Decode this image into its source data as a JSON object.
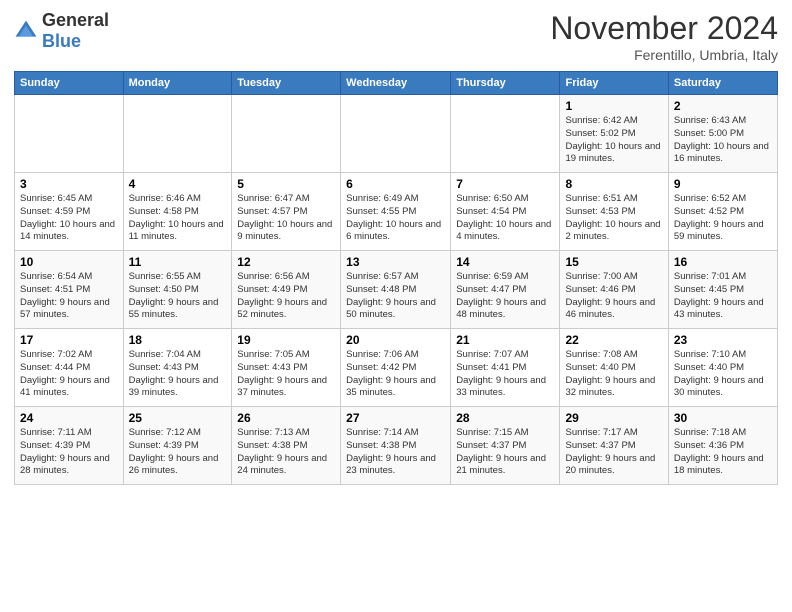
{
  "header": {
    "logo_general": "General",
    "logo_blue": "Blue",
    "month_title": "November 2024",
    "location": "Ferentillo, Umbria, Italy"
  },
  "weekdays": [
    "Sunday",
    "Monday",
    "Tuesday",
    "Wednesday",
    "Thursday",
    "Friday",
    "Saturday"
  ],
  "weeks": [
    [
      {
        "day": "",
        "info": ""
      },
      {
        "day": "",
        "info": ""
      },
      {
        "day": "",
        "info": ""
      },
      {
        "day": "",
        "info": ""
      },
      {
        "day": "",
        "info": ""
      },
      {
        "day": "1",
        "info": "Sunrise: 6:42 AM\nSunset: 5:02 PM\nDaylight: 10 hours and 19 minutes."
      },
      {
        "day": "2",
        "info": "Sunrise: 6:43 AM\nSunset: 5:00 PM\nDaylight: 10 hours and 16 minutes."
      }
    ],
    [
      {
        "day": "3",
        "info": "Sunrise: 6:45 AM\nSunset: 4:59 PM\nDaylight: 10 hours and 14 minutes."
      },
      {
        "day": "4",
        "info": "Sunrise: 6:46 AM\nSunset: 4:58 PM\nDaylight: 10 hours and 11 minutes."
      },
      {
        "day": "5",
        "info": "Sunrise: 6:47 AM\nSunset: 4:57 PM\nDaylight: 10 hours and 9 minutes."
      },
      {
        "day": "6",
        "info": "Sunrise: 6:49 AM\nSunset: 4:55 PM\nDaylight: 10 hours and 6 minutes."
      },
      {
        "day": "7",
        "info": "Sunrise: 6:50 AM\nSunset: 4:54 PM\nDaylight: 10 hours and 4 minutes."
      },
      {
        "day": "8",
        "info": "Sunrise: 6:51 AM\nSunset: 4:53 PM\nDaylight: 10 hours and 2 minutes."
      },
      {
        "day": "9",
        "info": "Sunrise: 6:52 AM\nSunset: 4:52 PM\nDaylight: 9 hours and 59 minutes."
      }
    ],
    [
      {
        "day": "10",
        "info": "Sunrise: 6:54 AM\nSunset: 4:51 PM\nDaylight: 9 hours and 57 minutes."
      },
      {
        "day": "11",
        "info": "Sunrise: 6:55 AM\nSunset: 4:50 PM\nDaylight: 9 hours and 55 minutes."
      },
      {
        "day": "12",
        "info": "Sunrise: 6:56 AM\nSunset: 4:49 PM\nDaylight: 9 hours and 52 minutes."
      },
      {
        "day": "13",
        "info": "Sunrise: 6:57 AM\nSunset: 4:48 PM\nDaylight: 9 hours and 50 minutes."
      },
      {
        "day": "14",
        "info": "Sunrise: 6:59 AM\nSunset: 4:47 PM\nDaylight: 9 hours and 48 minutes."
      },
      {
        "day": "15",
        "info": "Sunrise: 7:00 AM\nSunset: 4:46 PM\nDaylight: 9 hours and 46 minutes."
      },
      {
        "day": "16",
        "info": "Sunrise: 7:01 AM\nSunset: 4:45 PM\nDaylight: 9 hours and 43 minutes."
      }
    ],
    [
      {
        "day": "17",
        "info": "Sunrise: 7:02 AM\nSunset: 4:44 PM\nDaylight: 9 hours and 41 minutes."
      },
      {
        "day": "18",
        "info": "Sunrise: 7:04 AM\nSunset: 4:43 PM\nDaylight: 9 hours and 39 minutes."
      },
      {
        "day": "19",
        "info": "Sunrise: 7:05 AM\nSunset: 4:43 PM\nDaylight: 9 hours and 37 minutes."
      },
      {
        "day": "20",
        "info": "Sunrise: 7:06 AM\nSunset: 4:42 PM\nDaylight: 9 hours and 35 minutes."
      },
      {
        "day": "21",
        "info": "Sunrise: 7:07 AM\nSunset: 4:41 PM\nDaylight: 9 hours and 33 minutes."
      },
      {
        "day": "22",
        "info": "Sunrise: 7:08 AM\nSunset: 4:40 PM\nDaylight: 9 hours and 32 minutes."
      },
      {
        "day": "23",
        "info": "Sunrise: 7:10 AM\nSunset: 4:40 PM\nDaylight: 9 hours and 30 minutes."
      }
    ],
    [
      {
        "day": "24",
        "info": "Sunrise: 7:11 AM\nSunset: 4:39 PM\nDaylight: 9 hours and 28 minutes."
      },
      {
        "day": "25",
        "info": "Sunrise: 7:12 AM\nSunset: 4:39 PM\nDaylight: 9 hours and 26 minutes."
      },
      {
        "day": "26",
        "info": "Sunrise: 7:13 AM\nSunset: 4:38 PM\nDaylight: 9 hours and 24 minutes."
      },
      {
        "day": "27",
        "info": "Sunrise: 7:14 AM\nSunset: 4:38 PM\nDaylight: 9 hours and 23 minutes."
      },
      {
        "day": "28",
        "info": "Sunrise: 7:15 AM\nSunset: 4:37 PM\nDaylight: 9 hours and 21 minutes."
      },
      {
        "day": "29",
        "info": "Sunrise: 7:17 AM\nSunset: 4:37 PM\nDaylight: 9 hours and 20 minutes."
      },
      {
        "day": "30",
        "info": "Sunrise: 7:18 AM\nSunset: 4:36 PM\nDaylight: 9 hours and 18 minutes."
      }
    ]
  ]
}
